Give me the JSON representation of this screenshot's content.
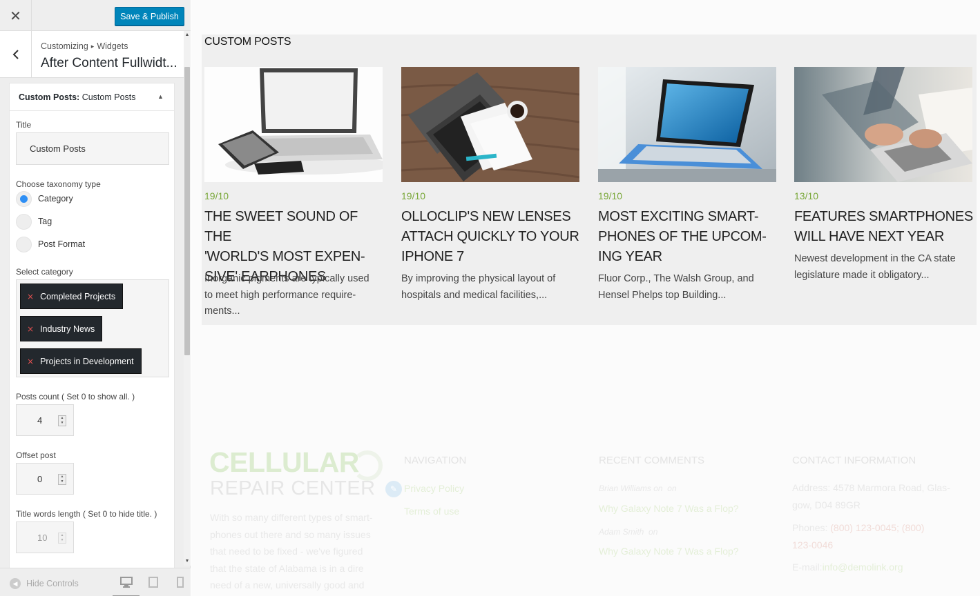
{
  "sidebar": {
    "save_label": "Save & Publish",
    "breadcrumb": [
      "Customizing",
      "Widgets"
    ],
    "panel_title": "After Content Fullwidt...",
    "widget": {
      "title_prefix": "Custom Posts:",
      "title_name": "Custom Posts",
      "title_label": "Title",
      "title_value": "Custom Posts",
      "taxonomy_label": "Choose taxonomy type",
      "taxonomy_options": [
        "Category",
        "Tag",
        "Post Format"
      ],
      "taxonomy_selected": "Category",
      "category_label": "Select category",
      "categories": [
        "Completed Projects",
        "Industry News",
        "Projects in Development"
      ],
      "posts_count_label": "Posts count ( Set 0 to show all. )",
      "posts_count": "4",
      "offset_label": "Offset post",
      "offset": "0",
      "title_words_label": "Title words length ( Set 0 to hide title. )",
      "title_words": "10"
    },
    "hide_controls": "Hide Controls",
    "device_icons": [
      "desktop-icon",
      "tablet-icon",
      "mobile-icon"
    ]
  },
  "preview": {
    "section_title": "CUSTOM POSTS",
    "posts": [
      {
        "date": "19/10",
        "title": "THE SWEET SOUND OF THE 'WORLD'S MOST EXPEN-SIVE' EARPHONES",
        "title_lines": [
          "THE SWEET SOUND OF THE",
          "'WORLD'S MOST EXPEN-",
          "SIVE' EARPHONES"
        ],
        "excerpt_lines": [
          "Inorganic pigments are typically used",
          "to meet high performance require-",
          "ments..."
        ]
      },
      {
        "date": "19/10",
        "title": "OLLOCLIP'S NEW LENSES ATTACH QUICKLY TO YOUR IPHONE 7",
        "title_lines": [
          "OLLOCLIP'S NEW LENSES",
          "ATTACH QUICKLY TO YOUR",
          "IPHONE 7"
        ],
        "excerpt_lines": [
          "By improving the physical layout of",
          "hospitals and medical facilities,..."
        ]
      },
      {
        "date": "19/10",
        "title": "MOST EXCITING SMART-PHONES OF THE UPCOM-ING YEAR",
        "title_lines": [
          "MOST EXCITING SMART-",
          "PHONES OF THE UPCOM-",
          "ING YEAR"
        ],
        "excerpt_lines": [
          "Fluor Corp., The Walsh Group, and",
          "Hensel Phelps top Building..."
        ]
      },
      {
        "date": "13/10",
        "title": "FEATURES SMARTPHONES WILL HAVE NEXT YEAR",
        "title_lines": [
          "FEATURES SMARTPHONES",
          "WILL HAVE NEXT YEAR"
        ],
        "excerpt_lines": [
          "Newest development in the CA state",
          "legislature made it obligatory..."
        ]
      }
    ],
    "footer": {
      "logo_top": "CELLULAR",
      "logo_bottom": "REPAIR CENTER",
      "about_lines": [
        "With so many different types of smart-",
        "phones out there and so many issues",
        "that need to be fixed - we've figured",
        "that the state of Alabama is in a dire",
        "need of a new, universally good and"
      ],
      "nav_title": "NAVIGATION",
      "nav_links": [
        "Privacy Policy",
        "Terms of use"
      ],
      "comments_title": "RECENT COMMENTS",
      "comments": [
        {
          "author": "Brian Williams on",
          "on": "on",
          "link": "Why Galaxy Note 7 Was a Flop?"
        },
        {
          "author": "Adam Smith",
          "on": "on",
          "link": "Why Galaxy Note 7 Was a Flop?"
        }
      ],
      "contact_title": "CONTACT INFORMATION",
      "address_lines": [
        "Address: 4578 Marmora Road, Glas-",
        "gow, D04 89GR"
      ],
      "phones_label": "Phones:",
      "phones_value_line1": "(800) 123-0045; (800)",
      "phones_value_line2": "123-0046",
      "email_label": "E-mail:",
      "email_value": "info@demolink.org"
    }
  }
}
